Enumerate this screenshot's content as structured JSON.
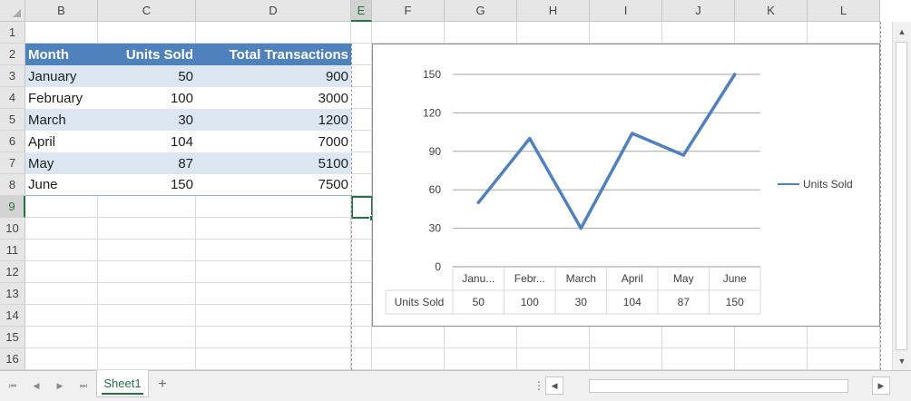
{
  "columns": [
    "B",
    "C",
    "D",
    "E",
    "F",
    "G",
    "H",
    "I",
    "J",
    "K",
    "L"
  ],
  "selected_column": "E",
  "rows": [
    "1",
    "2",
    "3",
    "4",
    "5",
    "6",
    "7",
    "8",
    "9",
    "10",
    "11",
    "12",
    "13",
    "14",
    "15",
    "16"
  ],
  "selected_row": "9",
  "table": {
    "headers": [
      "Month",
      "Units Sold",
      "Total Transactions"
    ],
    "rows": [
      [
        "January",
        "50",
        "900"
      ],
      [
        "February",
        "100",
        "3000"
      ],
      [
        "March",
        "30",
        "1200"
      ],
      [
        "April",
        "104",
        "7000"
      ],
      [
        "May",
        "87",
        "5100"
      ],
      [
        "June",
        "150",
        "7500"
      ]
    ],
    "header_color": "#4f81bd",
    "band_color": "#dce6f1"
  },
  "chart_data": {
    "type": "line",
    "categories": [
      "January",
      "February",
      "March",
      "April",
      "May",
      "June"
    ],
    "category_display": [
      "Janu...",
      "Febr...",
      "March",
      "April",
      "May",
      "June"
    ],
    "series": [
      {
        "name": "Units Sold",
        "values": [
          50,
          100,
          30,
          104,
          87,
          150
        ],
        "color": "#4f81bd"
      }
    ],
    "y_ticks": [
      "0",
      "30",
      "60",
      "90",
      "120",
      "150"
    ],
    "ylim": [
      0,
      150
    ],
    "grid": true,
    "legend_position": "right",
    "data_table": true,
    "data_table_values": [
      "50",
      "100",
      "30",
      "104",
      "87",
      "150"
    ]
  },
  "sheet_tabs": [
    "Sheet1"
  ],
  "active_sheet": "Sheet1",
  "icons": {
    "add_sheet": "+",
    "first_sheet": "⏮",
    "prev_sheet": "◀",
    "next_sheet": "▶",
    "last_sheet": "⏭",
    "scroll_up": "▲",
    "scroll_down": "▼",
    "scroll_left": "◀",
    "scroll_right": "▶",
    "grip": "⋮"
  }
}
